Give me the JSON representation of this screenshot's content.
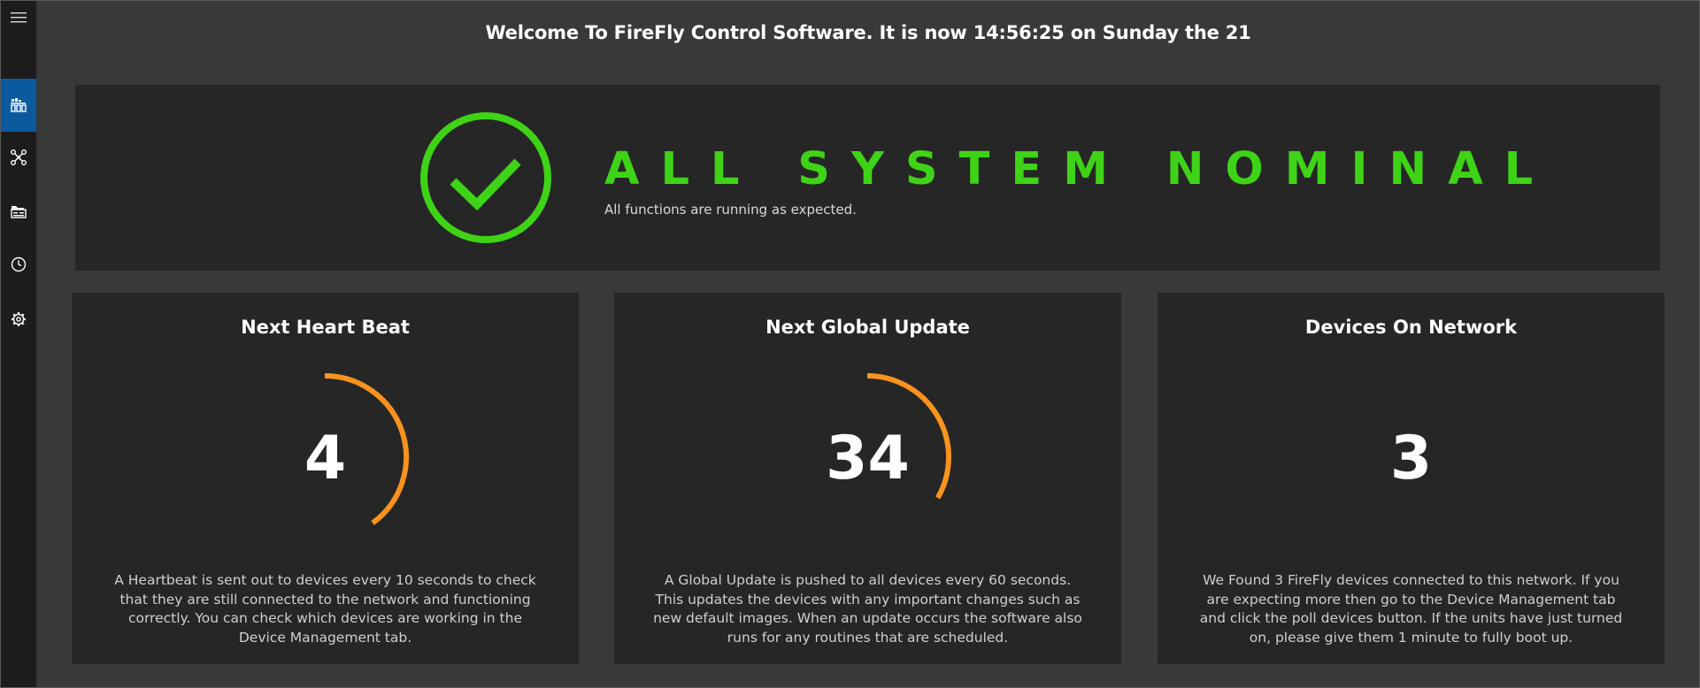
{
  "header": {
    "welcome": "Welcome To FireFly Control Software. It is now 14:56:25 on Sunday the 21"
  },
  "sidebar": {
    "items": [
      {
        "icon": "hamburger-menu-icon",
        "active": false
      },
      {
        "icon": "dashboard-icon",
        "active": true
      },
      {
        "icon": "network-nodes-icon",
        "active": false
      },
      {
        "icon": "folder-image-icon",
        "active": false
      },
      {
        "icon": "clock-icon",
        "active": false
      },
      {
        "icon": "gear-icon",
        "active": false
      }
    ],
    "active_color": "#0b5aa0"
  },
  "status": {
    "title": "ALL SYSTEM NOMINAL",
    "subtitle": "All functions are running as expected.",
    "icon": "checkmark-circle-icon",
    "color": "#3fd317"
  },
  "cards": [
    {
      "title": "Next Heart Beat",
      "value": "4",
      "progress": 0.4,
      "ring_color": "#f7931e",
      "description": "A Heartbeat is sent out to devices every 10 seconds to check that they are still connected to the network and functioning correctly. You can check which devices are working in the Device Management tab."
    },
    {
      "title": "Next Global Update",
      "value": "34",
      "progress": 0.3333,
      "ring_color": "#f7931e",
      "description": "A Global Update is pushed to all devices every 60 seconds. This updates the devices with any important changes such as new default images. When an update occurs the software also runs for any routines that are scheduled."
    },
    {
      "title": "Devices On Network",
      "value": "3",
      "progress": 0,
      "ring_color": "#f7931e",
      "description": "We Found 3 FireFly devices connected to this network. If you are expecting more then go to the Device Management tab and click the poll devices button. If the units have just turned on, please give them 1 minute to fully boot up."
    }
  ]
}
